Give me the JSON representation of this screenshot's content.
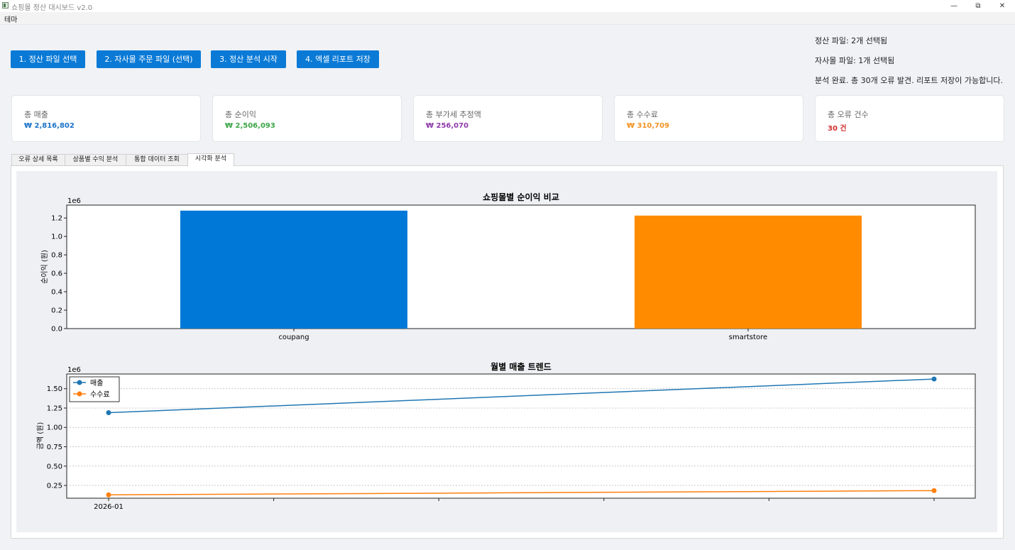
{
  "window": {
    "title": "쇼핑몰 정산 대시보드 v2.0"
  },
  "menu": {
    "items": [
      "테마"
    ]
  },
  "actions": {
    "select_settlement": "1. 정산 파일 선택",
    "select_orders": "2. 자사몰 주문 파일 (선택)",
    "start_analysis": "3. 정산 분석 시작",
    "save_excel": "4. 엑셀 리포트 저장"
  },
  "status": {
    "settlement_files": "정산 파일: 2개 선택됨",
    "own_files": "자사몰 파일: 1개 선택됨",
    "analysis": "분석 완료. 총 30개 오류 발견. 리포트 저장이 가능합니다."
  },
  "cards": [
    {
      "label": "총 매출",
      "value": "₩ 2,816,802",
      "color": "#1a73c8"
    },
    {
      "label": "총 순이익",
      "value": "₩ 2,506,093",
      "color": "#3aa547"
    },
    {
      "label": "총 부가세 추정액",
      "value": "₩ 256,070",
      "color": "#8e3aa9"
    },
    {
      "label": "총 수수료",
      "value": "₩ 310,709",
      "color": "#f39321"
    },
    {
      "label": "총 오류 건수",
      "value": "30 건",
      "color": "#d32f2f"
    }
  ],
  "tabs": [
    {
      "label": "오류 상세 목록",
      "active": false
    },
    {
      "label": "상품별 수익 분석",
      "active": false
    },
    {
      "label": "통합 데이터 조회",
      "active": false
    },
    {
      "label": "시각화 분석",
      "active": true
    }
  ],
  "chart_data": [
    {
      "type": "bar",
      "title": "쇼핑몰별 순이익 비교",
      "xlabel": "",
      "ylabel": "순이익 (원)",
      "offset_label": "1e6",
      "categories": [
        "coupang",
        "smartstore"
      ],
      "values": [
        1280000,
        1226000
      ],
      "colors": [
        "#0078d7",
        "#ff8c00"
      ],
      "ylim": [
        0,
        1340000
      ],
      "yticks": [
        0,
        200000,
        400000,
        600000,
        800000,
        1000000,
        1200000
      ],
      "ytick_labels": [
        "0.0",
        "0.2",
        "0.4",
        "0.6",
        "0.8",
        "1.0",
        "1.2"
      ],
      "grid": false
    },
    {
      "type": "line",
      "title": "월별 매출 트렌드",
      "xlabel": "",
      "ylabel": "금액 (원)",
      "offset_label": "1e6",
      "x": [
        "2026-01",
        ""
      ],
      "x_tick_count": 6,
      "xtick_labels": [
        "2026-01",
        "",
        "",
        "",
        "",
        ""
      ],
      "series": [
        {
          "name": "매출",
          "values": [
            1190000,
            1625000
          ],
          "color": "#1f77b4"
        },
        {
          "name": "수수료",
          "values": [
            128000,
            183000
          ],
          "color": "#ff7f0e"
        }
      ],
      "ylim": [
        85000,
        1690000
      ],
      "yticks": [
        250000,
        500000,
        750000,
        1000000,
        1250000,
        1500000
      ],
      "ytick_labels": [
        "0.25",
        "0.50",
        "0.75",
        "1.00",
        "1.25",
        "1.50"
      ],
      "grid": true,
      "legend": "top-left"
    }
  ]
}
